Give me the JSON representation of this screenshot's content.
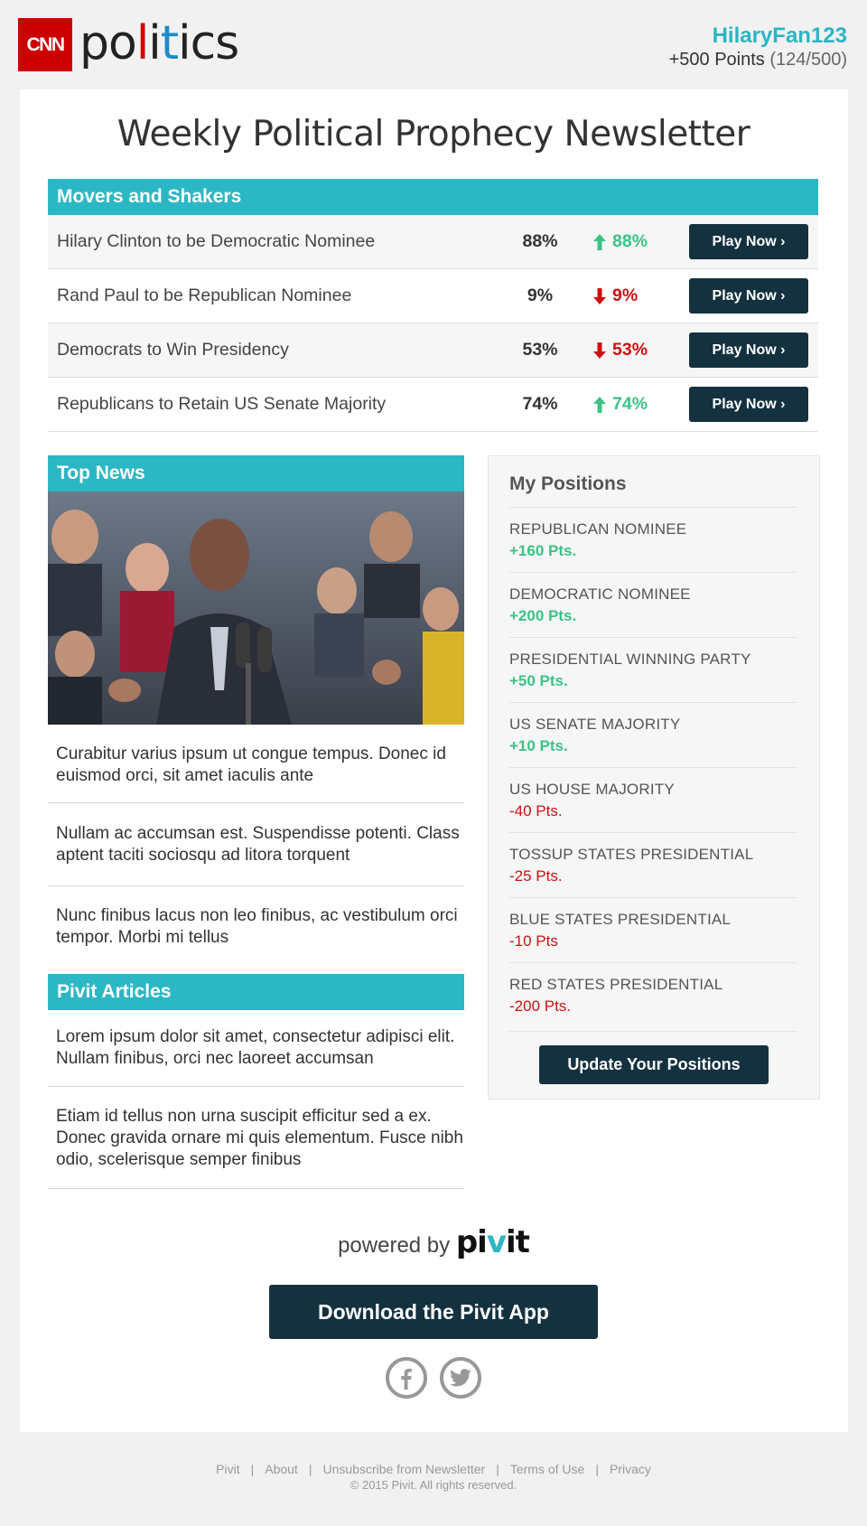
{
  "header": {
    "logo_box": "CNN",
    "logo_word_1": "po",
    "logo_word_2": "l",
    "logo_word_3": "i",
    "logo_word_4": "t",
    "logo_word_5": "ics",
    "username": "HilaryFan123",
    "points": "+500 Points",
    "points_progress": "(124/500)"
  },
  "title": "Weekly Political Prophecy Newsletter",
  "movers": {
    "heading": "Movers and Shakers",
    "rows": [
      {
        "label": "Hilary Clinton to be Democratic Nominee",
        "pct": "88%",
        "change": "88%",
        "direction": "up",
        "button": "Play Now ›"
      },
      {
        "label": "Rand Paul to be Republican Nominee",
        "pct": "9%",
        "change": "9%",
        "direction": "down",
        "button": "Play Now ›"
      },
      {
        "label": "Democrats to Win Presidency",
        "pct": "53%",
        "change": "53%",
        "direction": "down",
        "button": "Play Now ›"
      },
      {
        "label": "Republicans to Retain US Senate Majority",
        "pct": "74%",
        "change": "74%",
        "direction": "up",
        "button": "Play Now ›"
      }
    ]
  },
  "top_news": {
    "heading": "Top News",
    "items": [
      "Curabitur varius ipsum ut congue tempus. Donec id euismod orci, sit amet iaculis ante",
      "Nullam ac accumsan est. Suspendisse potenti. Class aptent taciti sociosqu ad litora torquent",
      "Nunc finibus lacus non leo finibus, ac vestibulum orci tempor. Morbi mi tellus"
    ]
  },
  "pivit_articles": {
    "heading": "Pivit Articles",
    "items": [
      "Lorem ipsum dolor sit amet, consectetur adipisci elit. Nullam finibus, orci nec laoreet accumsan",
      "Etiam id tellus non urna suscipit efficitur sed a ex. Donec gravida ornare mi quis elementum. Fusce nibh odio, scelerisque semper finibus"
    ]
  },
  "positions": {
    "heading": "My Positions",
    "items": [
      {
        "name": "REPUBLICAN NOMINEE",
        "value": "+160 Pts.",
        "sign": "pos"
      },
      {
        "name": "DEMOCRATIC NOMINEE",
        "value": "+200 Pts.",
        "sign": "pos"
      },
      {
        "name": "PRESIDENTIAL WINNING PARTY",
        "value": "+50 Pts.",
        "sign": "pos"
      },
      {
        "name": "US SENATE MAJORITY",
        "value": "+10 Pts.",
        "sign": "pos"
      },
      {
        "name": "US HOUSE MAJORITY",
        "value": "-40 Pts.",
        "sign": "neg"
      },
      {
        "name": "TOSSUP STATES PRESIDENTIAL",
        "value": "-25 Pts.",
        "sign": "neg"
      },
      {
        "name": "BLUE STATES PRESIDENTIAL",
        "value": "-10 Pts",
        "sign": "neg"
      },
      {
        "name": "RED STATES PRESIDENTIAL",
        "value": "-200 Pts.",
        "sign": "neg"
      }
    ],
    "button": "Update Your Positions"
  },
  "powered": {
    "text": "powered by",
    "brand_1": "pi",
    "brand_2": "v",
    "brand_3": "it"
  },
  "download_button": "Download the Pivit App",
  "social": [
    "facebook-icon",
    "twitter-icon"
  ],
  "footer": {
    "links": [
      "Pivit",
      "About",
      "Unsubscribe from Newsletter",
      "Terms of Use",
      "Privacy"
    ],
    "separator": "|",
    "copyright": "© 2015 Pivit. All rights reserved."
  },
  "colors": {
    "accent": "#2cb7c5",
    "dark": "#14313f",
    "up": "#3cc285",
    "down": "#cc1111",
    "brand_red": "#cc0000"
  }
}
